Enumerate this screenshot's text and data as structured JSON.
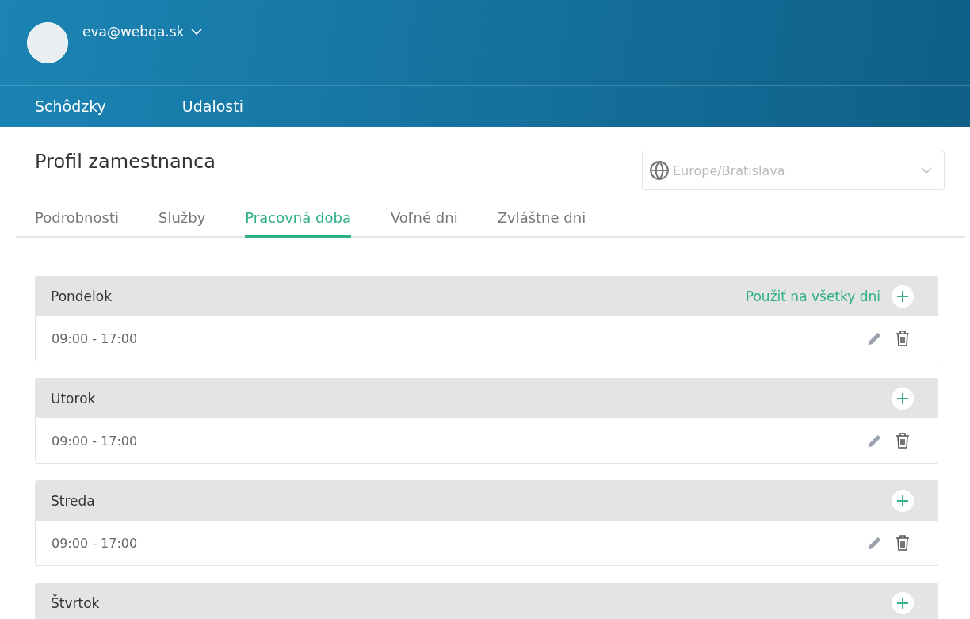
{
  "user": {
    "email": "eva@webqa.sk"
  },
  "nav": [
    {
      "label": "Schôdzky"
    },
    {
      "label": "Udalosti"
    }
  ],
  "page_title": "Profil zamestnanca",
  "timezone": {
    "value": "Europe/Bratislava"
  },
  "tabs": [
    {
      "label": "Podrobnosti",
      "selected": false
    },
    {
      "label": "Služby",
      "selected": false
    },
    {
      "label": "Pracovná doba",
      "selected": true
    },
    {
      "label": "Voľné dni",
      "selected": false
    },
    {
      "label": "Zvláštne dni",
      "selected": false
    }
  ],
  "days": [
    {
      "name": "Pondelok",
      "apply_all": "Použiť na všetky dni",
      "slots": [
        "09:00 - 17:00"
      ]
    },
    {
      "name": "Utorok",
      "slots": [
        "09:00 - 17:00"
      ]
    },
    {
      "name": "Streda",
      "slots": [
        "09:00 - 17:00"
      ]
    },
    {
      "name": "Štvrtok"
    }
  ]
}
